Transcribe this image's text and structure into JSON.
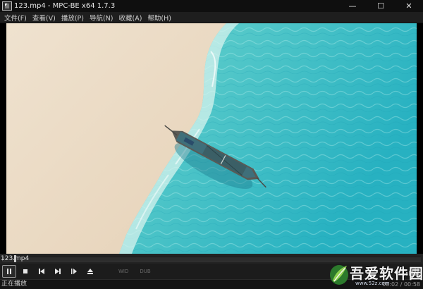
{
  "window": {
    "title": "123.mp4 - MPC-BE x64 1.7.3",
    "controls": {
      "minimize": "—",
      "maximize": "☐",
      "close": "✕"
    }
  },
  "menu": {
    "items": [
      {
        "label": "文件(F)"
      },
      {
        "label": "查看(V)"
      },
      {
        "label": "播放(P)"
      },
      {
        "label": "导航(N)"
      },
      {
        "label": "收藏(A)"
      },
      {
        "label": "帮助(H)"
      }
    ]
  },
  "seekbar": {
    "file_label": "123.mp4",
    "position_fraction": 0.0014
  },
  "controls": {
    "buttons": [
      "pause",
      "stop",
      "previous",
      "next",
      "frame-step",
      "eject"
    ],
    "labels": [
      "WID",
      "DUB"
    ]
  },
  "status": {
    "text": "正在播放",
    "time": "00:02 / 00:58"
  },
  "watermark": {
    "text": "吾爱软件园",
    "url": "www.52z.com"
  },
  "colors": {
    "sand": "#ecdcc6",
    "shallow_water": "#7fd8d0",
    "deep_water": "#2cb5c0",
    "chrome_bg": "#1b1b1b"
  }
}
